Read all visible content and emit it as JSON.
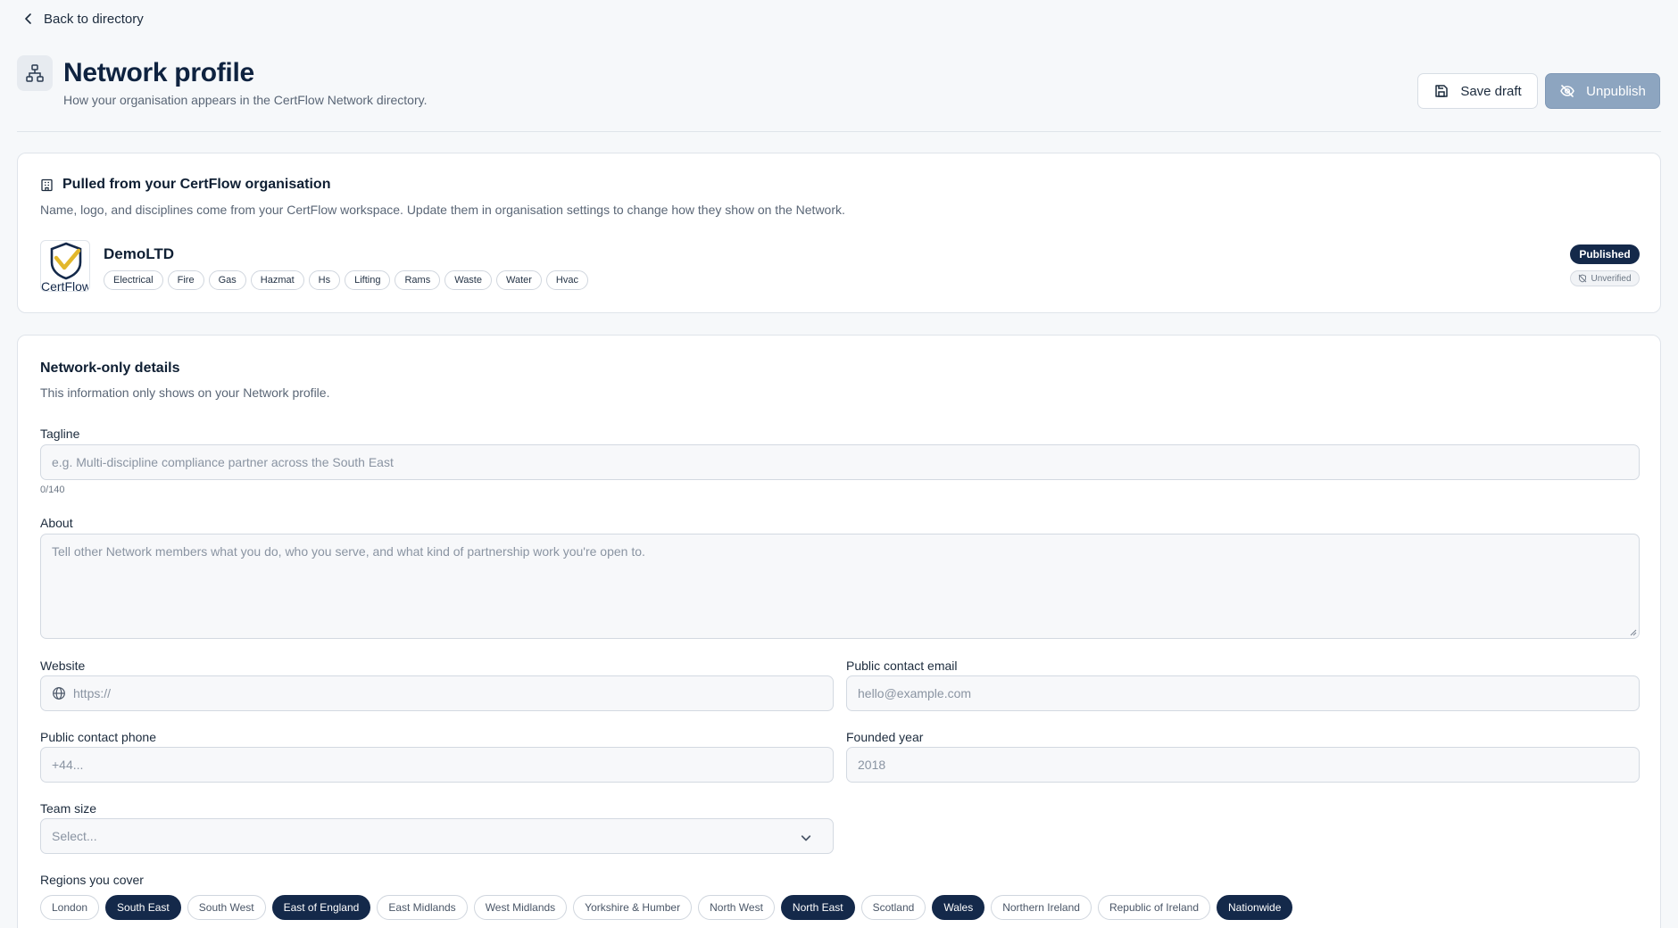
{
  "nav": {
    "back_label": "Back to directory"
  },
  "header": {
    "title": "Network profile",
    "subtitle": "How your organisation appears in the CertFlow Network directory.",
    "save_label": "Save draft",
    "unpublish_label": "Unpublish"
  },
  "org_card": {
    "heading": "Pulled from your CertFlow organisation",
    "description": "Name, logo, and disciplines come from your CertFlow workspace. Update them in organisation settings to change how they show on the Network.",
    "logo_text": "CertFlow",
    "org_name": "DemoLTD",
    "disciplines": [
      "Electrical",
      "Fire",
      "Gas",
      "Hazmat",
      "Hs",
      "Lifting",
      "Rams",
      "Waste",
      "Water",
      "Hvac"
    ],
    "status_badge": "Published",
    "verification_badge": "Unverified"
  },
  "network_card": {
    "heading": "Network-only details",
    "description": "This information only shows on your Network profile.",
    "tagline": {
      "label": "Tagline",
      "placeholder": "e.g. Multi-discipline compliance partner across the South East",
      "value": "",
      "counter": "0/140"
    },
    "about": {
      "label": "About",
      "placeholder": "Tell other Network members what you do, who you serve, and what kind of partnership work you're open to.",
      "value": ""
    },
    "website": {
      "label": "Website",
      "placeholder": "https://",
      "value": ""
    },
    "email": {
      "label": "Public contact email",
      "placeholder": "hello@example.com",
      "value": ""
    },
    "phone": {
      "label": "Public contact phone",
      "placeholder": "+44...",
      "value": ""
    },
    "founded": {
      "label": "Founded year",
      "placeholder": "2018",
      "value": ""
    },
    "team_size": {
      "label": "Team size",
      "selected": "Select..."
    },
    "regions": {
      "label": "Regions you cover",
      "items": [
        {
          "label": "London",
          "selected": false
        },
        {
          "label": "South East",
          "selected": true
        },
        {
          "label": "South West",
          "selected": false
        },
        {
          "label": "East of England",
          "selected": true
        },
        {
          "label": "East Midlands",
          "selected": false
        },
        {
          "label": "West Midlands",
          "selected": false
        },
        {
          "label": "Yorkshire & Humber",
          "selected": false
        },
        {
          "label": "North West",
          "selected": false
        },
        {
          "label": "North East",
          "selected": true
        },
        {
          "label": "Scotland",
          "selected": false
        },
        {
          "label": "Wales",
          "selected": true
        },
        {
          "label": "Northern Ireland",
          "selected": false
        },
        {
          "label": "Republic of Ireland",
          "selected": false
        },
        {
          "label": "Nationwide",
          "selected": true
        }
      ]
    }
  },
  "icons": {
    "back": "chevron-left-icon",
    "header": "network-icon",
    "save": "floppy-disk-icon",
    "unpublish": "eye-off-icon",
    "org": "building-icon",
    "website": "globe-icon",
    "select": "chevron-down-icon"
  },
  "colors": {
    "primary_dark": "#14294a",
    "disabled_button": "#8da5c0",
    "page_bg": "#f6f8fa"
  }
}
